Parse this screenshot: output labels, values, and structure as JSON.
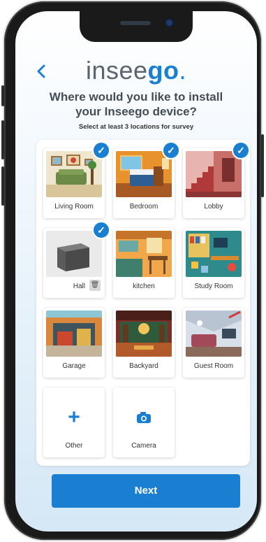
{
  "header": {
    "back_icon": "chevron-left-icon",
    "logo_prefix": "insee",
    "logo_accent": "go",
    "logo_dot": ".",
    "title_line1": "Where would you like to install",
    "title_line2": "your Inseego device?",
    "subtitle": "Select at least 3 locations for survey"
  },
  "locations": [
    {
      "label": "Living Room",
      "selected": true
    },
    {
      "label": "Bedroom",
      "selected": true
    },
    {
      "label": "Lobby",
      "selected": true
    },
    {
      "label": "Hall",
      "selected": true
    },
    {
      "label": "kitchen",
      "selected": false
    },
    {
      "label": "Study Room",
      "selected": false
    },
    {
      "label": "Garage",
      "selected": false
    },
    {
      "label": "Backyard",
      "selected": false
    },
    {
      "label": "Guest Room",
      "selected": false
    }
  ],
  "extra": {
    "other_label": "Other",
    "camera_label": "Camera"
  },
  "footer": {
    "next_label": "Next"
  },
  "colors": {
    "accent": "#1b7fd1",
    "text": "#444c54"
  }
}
